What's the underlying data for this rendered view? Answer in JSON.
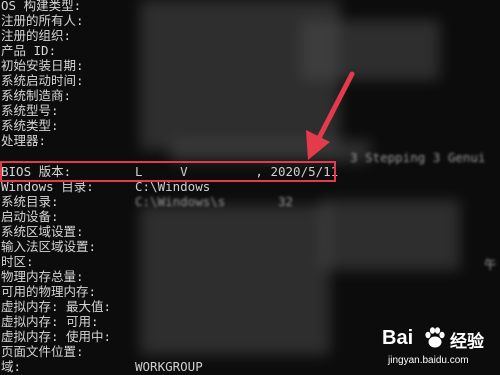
{
  "terminal": {
    "lines": [
      {
        "label": "OS 构建类型:",
        "value": ""
      },
      {
        "label": "注册的所有人:",
        "value": ""
      },
      {
        "label": "注册的组织:",
        "value": ""
      },
      {
        "label": "产品 ID:",
        "value": ""
      },
      {
        "label": "初始安装日期:",
        "value": ""
      },
      {
        "label": "系统启动时间:",
        "value": ""
      },
      {
        "label": "系统制造商:",
        "value": ""
      },
      {
        "label": "系统型号:",
        "value": ""
      },
      {
        "label": "系统类型:",
        "value": ""
      },
      {
        "label": "处理器:",
        "value": ""
      },
      {
        "label": "",
        "value": ""
      },
      {
        "label": "BIOS 版本:",
        "value": "L     V         , 2020/5/11"
      },
      {
        "label": "Windows 目录:",
        "value": "C:\\Windows"
      },
      {
        "label": "系统目录:",
        "value": ""
      },
      {
        "label": "启动设备:",
        "value": ""
      },
      {
        "label": "系统区域设置:",
        "value": ""
      },
      {
        "label": "输入法区域设置:",
        "value": ""
      },
      {
        "label": "时区:",
        "value": ""
      },
      {
        "label": "物理内存总量:",
        "value": ""
      },
      {
        "label": "可用的物理内存:",
        "value": ""
      },
      {
        "label": "虚拟内存: 最大值:",
        "value": ""
      },
      {
        "label": "虚拟内存: 可用:",
        "value": ""
      },
      {
        "label": "虚拟内存: 使用中:",
        "value": ""
      },
      {
        "label": "页面文件位置:",
        "value": ""
      },
      {
        "label": "域:",
        "value": "WORKGROUP"
      }
    ],
    "processor_tail": "3 Stepping 3 Genui",
    "timezone_tail": "午",
    "system_dir_tail": "C:\\Windows\\s       32"
  },
  "annotation": {
    "highlight_color": "#e23b4a",
    "arrow_color": "#e23b4a"
  },
  "watermark": {
    "logo": "Bai",
    "logo_cn": "经验",
    "url": "jingyan.baidu.com",
    "paw_icon": "paw-icon"
  }
}
